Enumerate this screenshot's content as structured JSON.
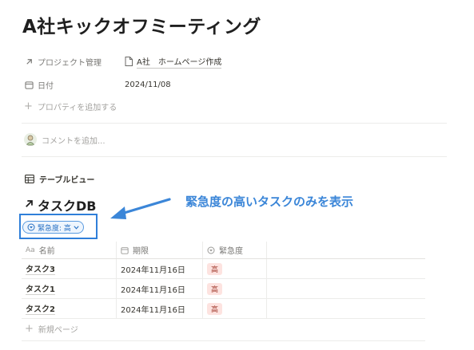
{
  "page": {
    "title": "A社キックオフミーティング"
  },
  "properties": [
    {
      "key": "プロジェクト管理",
      "value": "A社　ホームページ作成",
      "icon": "arrow-up-right-icon"
    },
    {
      "key": "日付",
      "value": "2024/11/08",
      "icon": "calendar-icon"
    }
  ],
  "add_property_label": "プロパティを追加する",
  "comment_placeholder": "コメントを追加...",
  "view": {
    "label": "テーブルビュー",
    "database_title": "タスクDB"
  },
  "filter": {
    "label": "緊急度: 高"
  },
  "annotation": {
    "text": "緊急度の高いタスクのみを表示",
    "color": "#3b86d8"
  },
  "table": {
    "columns": [
      {
        "label": "名前",
        "icon": "Aa"
      },
      {
        "label": "期限",
        "icon": "calendar-icon"
      },
      {
        "label": "緊急度",
        "icon": "status-icon"
      }
    ],
    "rows": [
      {
        "name": "タスク3",
        "due": "2024年11月16日",
        "urgency": "高"
      },
      {
        "name": "タスク1",
        "due": "2024年11月16日",
        "urgency": "高"
      },
      {
        "name": "タスク2",
        "due": "2024年11月16日",
        "urgency": "高"
      }
    ],
    "new_page_label": "新規ページ"
  },
  "colors": {
    "accent_blue": "#2f7fd9",
    "tag_bg": "#fde3e0",
    "tag_text": "#a03a2d"
  }
}
